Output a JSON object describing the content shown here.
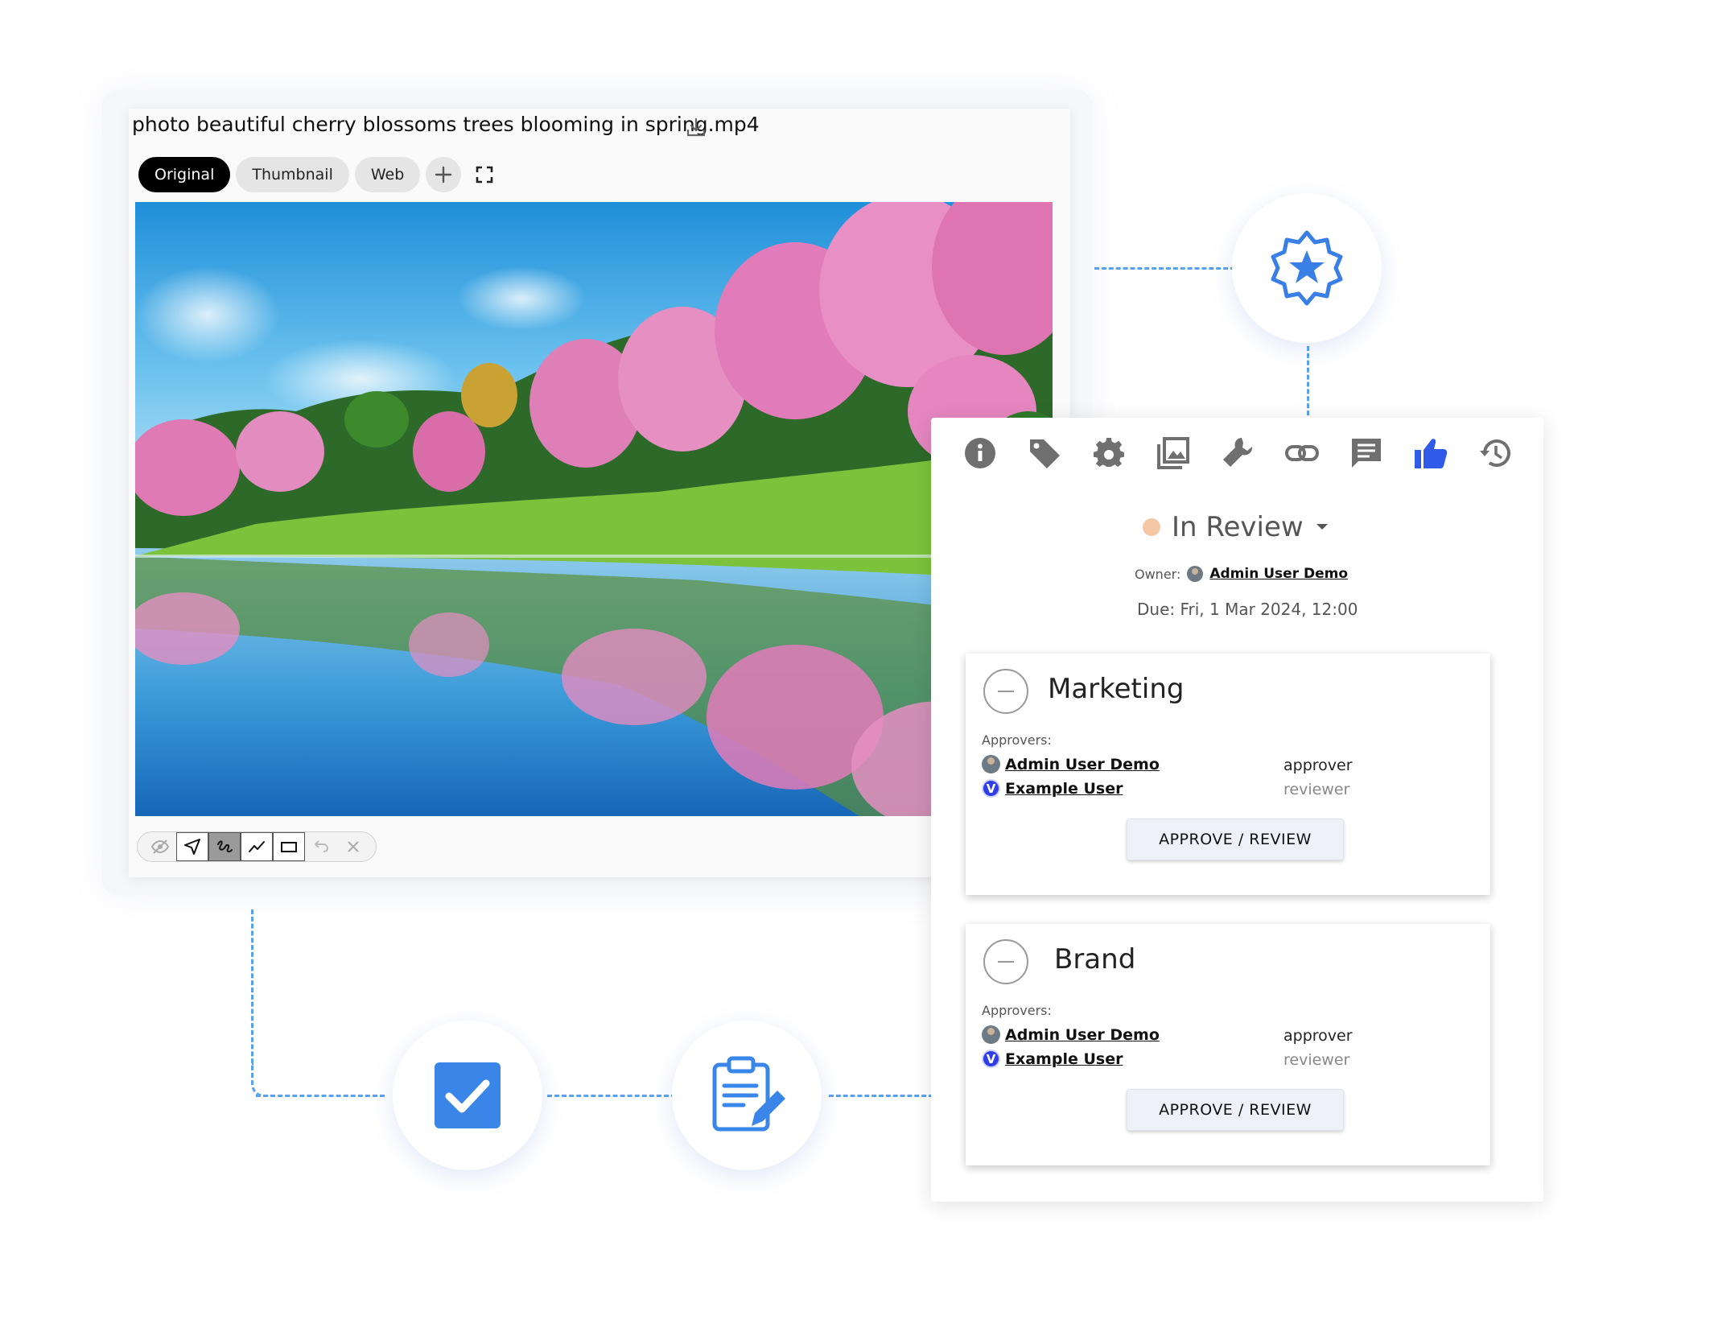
{
  "viewer": {
    "file_title": "photo beautiful cherry blossoms trees blooming in spring.mp4",
    "download_icon": "download-icon",
    "tabs": [
      "Original",
      "Thumbnail",
      "Web"
    ],
    "active_tab": "Original",
    "add_icon": "plus-icon",
    "fullscreen_icon": "fullscreen-icon",
    "annotation_tools": [
      "hide-annotations-icon",
      "pointer-icon",
      "freehand-icon",
      "line-icon",
      "rectangle-icon",
      "undo-icon",
      "close-icon"
    ]
  },
  "panel": {
    "icons": [
      "info-icon",
      "tag-icon",
      "gear-icon",
      "images-icon",
      "wrench-icon",
      "link-icon",
      "comment-icon",
      "thumbs-up-icon",
      "history-icon"
    ],
    "active_icon": "thumbs-up-icon",
    "status": {
      "label": "In Review",
      "dot_color": "#f6c7a7"
    },
    "owner_label": "Owner:",
    "owner_name": "Admin User Demo",
    "due": "Due: Fri, 1 Mar 2024, 12:00",
    "groups": [
      {
        "title": "Marketing",
        "approvers_label": "Approvers:",
        "approvers": [
          {
            "name": "Admin User Demo",
            "role": "approver"
          },
          {
            "name": "Example User",
            "role": "reviewer",
            "avatar_letter": "V"
          }
        ],
        "button": "APPROVE / REVIEW"
      },
      {
        "title": "Brand",
        "approvers_label": "Approvers:",
        "approvers": [
          {
            "name": "Admin User Demo",
            "role": "approver"
          },
          {
            "name": "Example User",
            "role": "reviewer",
            "avatar_letter": "V"
          }
        ],
        "button": "APPROVE / REVIEW"
      }
    ]
  },
  "decor": {
    "badge_icon": "star-badge-icon",
    "check_icon": "checkbox-checked-icon",
    "clipboard_icon": "clipboard-edit-icon",
    "accent": "#3a86e8",
    "active_blue": "#2f5be8"
  }
}
